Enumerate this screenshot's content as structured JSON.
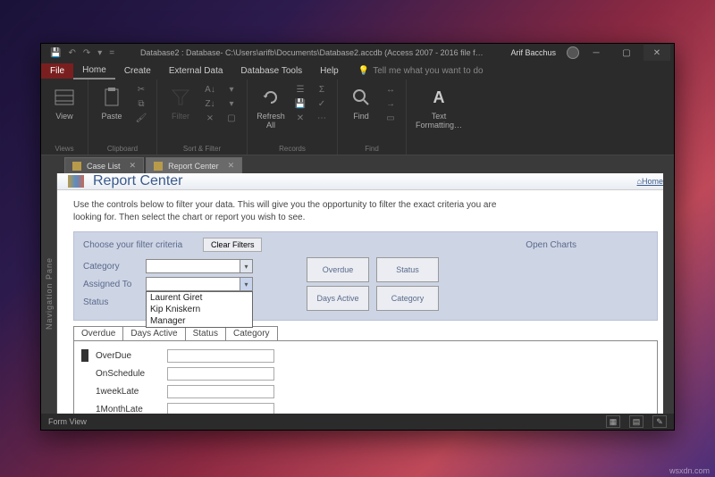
{
  "title": "Database2 : Database- C:\\Users\\arifb\\Documents\\Database2.accdb (Access 2007 - 2016 file f…",
  "user": "Arif Bacchus",
  "menu": {
    "file": "File",
    "home": "Home",
    "create": "Create",
    "external": "External Data",
    "dbtools": "Database Tools",
    "help": "Help",
    "tellme": "Tell me what you want to do"
  },
  "ribbon": {
    "view": "View",
    "views_g": "Views",
    "paste": "Paste",
    "clipboard_g": "Clipboard",
    "filter": "Filter",
    "sortfilter_g": "Sort & Filter",
    "refresh": "Refresh\nAll",
    "records_g": "Records",
    "find": "Find",
    "find_g": "Find",
    "textfmt": "Text\nFormatting…"
  },
  "doctabs": {
    "case": "Case List",
    "report": "Report Center"
  },
  "navpane": "Navigation Pane",
  "page": {
    "title": "Report Center",
    "home_link": "Home",
    "desc": "Use the controls below to filter your data. This will give you the opportunity to filter the exact criteria you are looking for. Then select the chart or report you wish to see.",
    "choose": "Choose your filter criteria",
    "clear": "Clear Filters",
    "open_charts": "Open Charts",
    "category": "Category",
    "assigned": "Assigned To",
    "status": "Status",
    "dropdown": [
      "Laurent Giret",
      "Kip Kniskern",
      "Manager"
    ],
    "charts": {
      "overdue": "Overdue",
      "status": "Status",
      "days": "Days Active",
      "category": "Category"
    },
    "subtabs": [
      "Overdue",
      "Days Active",
      "Status",
      "Category"
    ],
    "rows": [
      "OverDue",
      "OnSchedule",
      "1weekLate",
      "1MonthLate"
    ]
  },
  "statusbar": "Form View",
  "watermark": "wsxdn.com"
}
